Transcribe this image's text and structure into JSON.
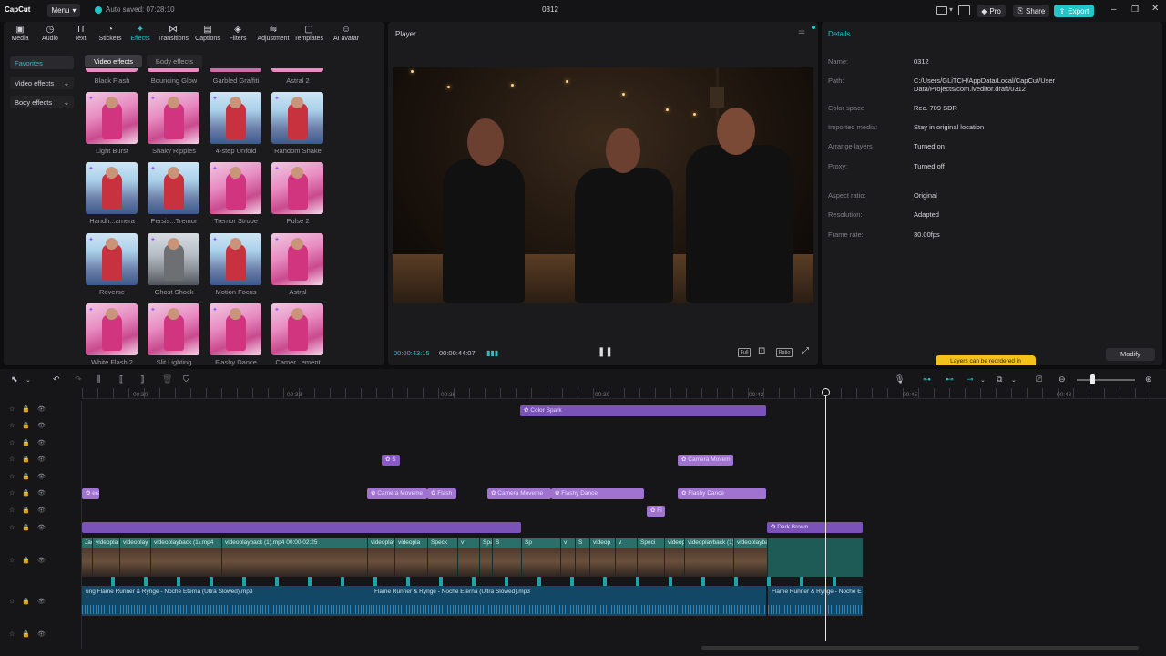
{
  "titlebar": {
    "logo": "CapCut",
    "menu_label": "Menu",
    "autosave": "Auto saved: 07:28:10",
    "project_title": "0312",
    "pro_label": "Pro",
    "share_label": "Share",
    "export_label": "Export"
  },
  "toolbar": [
    {
      "label": "Media",
      "icon": "▣"
    },
    {
      "label": "Audio",
      "icon": "◷"
    },
    {
      "label": "Text",
      "icon": "TI"
    },
    {
      "label": "Stickers",
      "icon": "◔"
    },
    {
      "label": "Effects",
      "icon": "✦"
    },
    {
      "label": "Transitions",
      "icon": "⋈"
    },
    {
      "label": "Captions",
      "icon": "▤"
    },
    {
      "label": "Filters",
      "icon": "◈"
    },
    {
      "label": "Adjustment",
      "icon": "⇋"
    },
    {
      "label": "Templates",
      "icon": "▢"
    },
    {
      "label": "AI avatar",
      "icon": "☺"
    }
  ],
  "sidebar": {
    "favorites": "Favorites",
    "video_effects": "Video effects",
    "body_effects": "Body effects"
  },
  "subtabs": {
    "video_effects": "Video effects",
    "body_effects": "Body effects"
  },
  "effects_top_labels": [
    "Black Flash",
    "Bouncing Glow",
    "Garbled Graffiti",
    "Astral 2"
  ],
  "effects": [
    {
      "name": "Light Burst",
      "style": "pink"
    },
    {
      "name": "Shaky Ripples",
      "style": "pink"
    },
    {
      "name": "4-step Unfold",
      "style": "blue"
    },
    {
      "name": "Random Shake",
      "style": "blue"
    },
    {
      "name": "Handh...amera",
      "style": "blue"
    },
    {
      "name": "Persis...Tremor",
      "style": "blue"
    },
    {
      "name": "Tremor Strobe",
      "style": "pink"
    },
    {
      "name": "Pulse 2",
      "style": "pink"
    },
    {
      "name": "Reverse",
      "style": "blue"
    },
    {
      "name": "Ghost Shock",
      "style": "gray"
    },
    {
      "name": "Motion Focus",
      "style": "blue"
    },
    {
      "name": "Astral",
      "style": "pink"
    },
    {
      "name": "White Flash 2",
      "style": "pink"
    },
    {
      "name": "Slit Lighting",
      "style": "pink"
    },
    {
      "name": "Flashy Dance",
      "style": "pink"
    },
    {
      "name": "Camer...ement",
      "style": "pink"
    }
  ],
  "player": {
    "title": "Player",
    "current_time": "00:00:43:15",
    "total_time": "00:00:44:07",
    "full_label": "Full",
    "ratio_label": "Ratio"
  },
  "details": {
    "title": "Details",
    "rows": [
      {
        "key": "Name:",
        "value": "0312"
      },
      {
        "key": "Path:",
        "value": "C:/Users/GLiTCH/AppData/Local/CapCut/User Data/Projects/com.lveditor.draft/0312"
      },
      {
        "key": "Color space",
        "value": "Rec. 709 SDR"
      },
      {
        "key": "Imported media:",
        "value": "Stay in original location"
      },
      {
        "key": "Arrange layers",
        "value": "Turned on"
      },
      {
        "key": "Proxy:",
        "value": "Turned off"
      },
      {
        "key": "Aspect ratio:",
        "value": "Original"
      },
      {
        "key": "Resolution:",
        "value": "Adapted"
      },
      {
        "key": "Frame rate:",
        "value": "30.00fps"
      }
    ],
    "tooltip": "Layers can be reordered in",
    "modify_label": "Modify"
  },
  "ruler": [
    "00:30",
    "00:33",
    "00:36",
    "00:39",
    "00:42",
    "00:45",
    "00:48"
  ],
  "effect_clips": [
    {
      "label": "Color Spark",
      "row": 0
    },
    {
      "label": "S",
      "row": 3
    },
    {
      "label": "Camera Movem",
      "row": 3
    },
    {
      "label": "era M",
      "row": 5
    },
    {
      "label": "Camera Moveme",
      "row": 5
    },
    {
      "label": "Flash",
      "row": 5
    },
    {
      "label": "Camera Moveme",
      "row": 5
    },
    {
      "label": "Flashy Dance",
      "row": 5
    },
    {
      "label": "Flashy Dance",
      "row": 5
    },
    {
      "label": "Fl",
      "row": 6
    },
    {
      "label": "",
      "row": 7
    },
    {
      "label": "Dark Brown",
      "row": 7
    }
  ],
  "video_clips": [
    "Jac",
    "videopla",
    "videoplay",
    "videoplayback (1).mp4",
    "videoplayback (1).mp4  00:00:02:25",
    "videoplay",
    "videopla",
    "Speck",
    "v",
    "Spa",
    "S",
    "Sp",
    "v",
    "S",
    "videop",
    "v",
    "Speci",
    "videoplayt",
    "videoplayback (1).mp4",
    "videoplayback (1).mp4  00:00:01"
  ],
  "audio_clips": [
    "ung  Flame Runner & Rynge - Noche Eterna (Ultra Slowed).mp3",
    "Flame Runner & Rynge - Noche Eterna (Ultra Slowed).mp3",
    "Flame Runner & Rynge - Noche E"
  ],
  "colors": {
    "accent": "#21c6c9",
    "effect_clip": "#7b52b8",
    "video_track": "#1e5a56",
    "audio_track": "#124766"
  }
}
